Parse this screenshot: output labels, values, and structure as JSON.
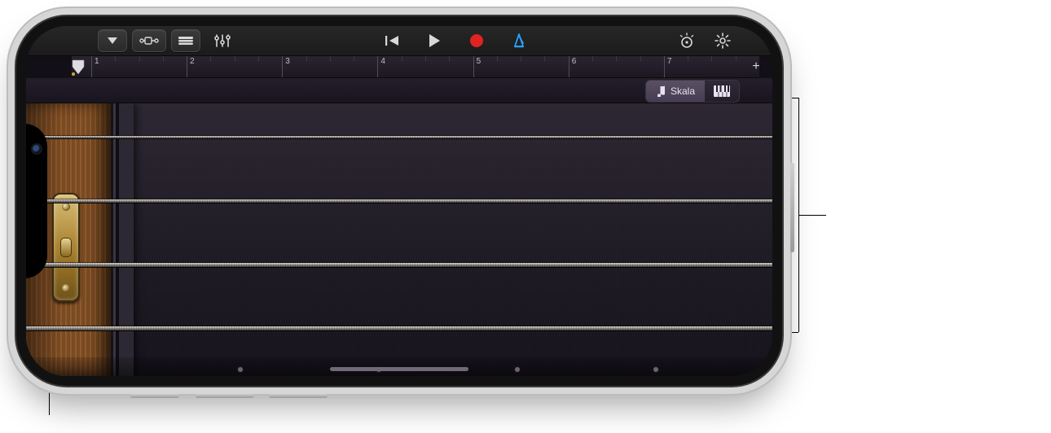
{
  "toolbar": {
    "menu_icon": "triangle-down-icon",
    "fx_icon": "fx-chain-icon",
    "automation_icon": "automation-icon",
    "mixer_icon": "mixer-icon",
    "rewind_icon": "rewind-icon",
    "play_icon": "play-icon",
    "record_icon": "record-icon",
    "metronome_icon": "metronome-icon",
    "view_icon": "view-dial-icon",
    "settings_icon": "gear-icon"
  },
  "ruler": {
    "bars": [
      "1",
      "2",
      "3",
      "4",
      "5",
      "6",
      "7"
    ],
    "plus_label": "+"
  },
  "mode": {
    "scale_label": "Skala",
    "scale_note_icon": "music-note-icon",
    "keyboard_icon": "keyboard-icon"
  },
  "instrument": {
    "string_count": 4,
    "fret_marker_positions": [
      260,
      430,
      600,
      770
    ]
  },
  "colors": {
    "accent_blue": "#2aa0ff",
    "record_red": "#e02320"
  }
}
